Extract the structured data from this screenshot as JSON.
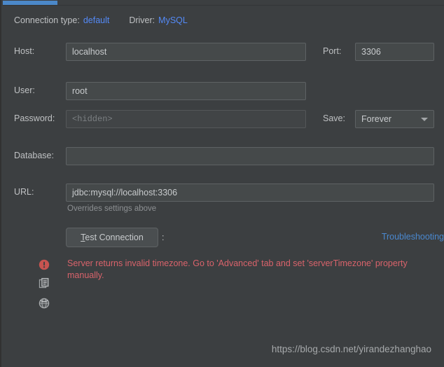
{
  "window": {
    "theme_bg": "#3c3f41",
    "accent": "#4b88c9",
    "link_color": "#4a88cf",
    "error_color": "#d9636b"
  },
  "header": {
    "connection_type_label": "Connection type:",
    "connection_type_value": "default",
    "driver_label": "Driver:",
    "driver_value": "MySQL"
  },
  "form": {
    "host": {
      "label": "Host:",
      "value": "localhost"
    },
    "port": {
      "label": "Port:",
      "value": "3306"
    },
    "user": {
      "label": "User:",
      "value": "root"
    },
    "password": {
      "label": "Password:",
      "value": "",
      "placeholder": "<hidden>"
    },
    "save": {
      "label": "Save:",
      "value": "Forever"
    },
    "database": {
      "label": "Database:",
      "value": "",
      "placeholder": ""
    },
    "url": {
      "label": "URL:",
      "value": "jdbc:mysql://localhost:3306",
      "hint": "Overrides settings above"
    }
  },
  "actions": {
    "test_connection_mnemonic": "T",
    "test_connection_rest": "est Connection",
    "test_connection_full": "Test Connection",
    "separator": ":",
    "troubleshooting": "Troubleshooting"
  },
  "status": {
    "message": "Server returns invalid timezone. Go to 'Advanced' tab and set 'serverTimezone' property manually.",
    "icons": [
      "error-icon",
      "copy-icon",
      "globe-icon"
    ]
  },
  "watermark": {
    "text": "https://blog.csdn.net/yirandezhanghao"
  }
}
